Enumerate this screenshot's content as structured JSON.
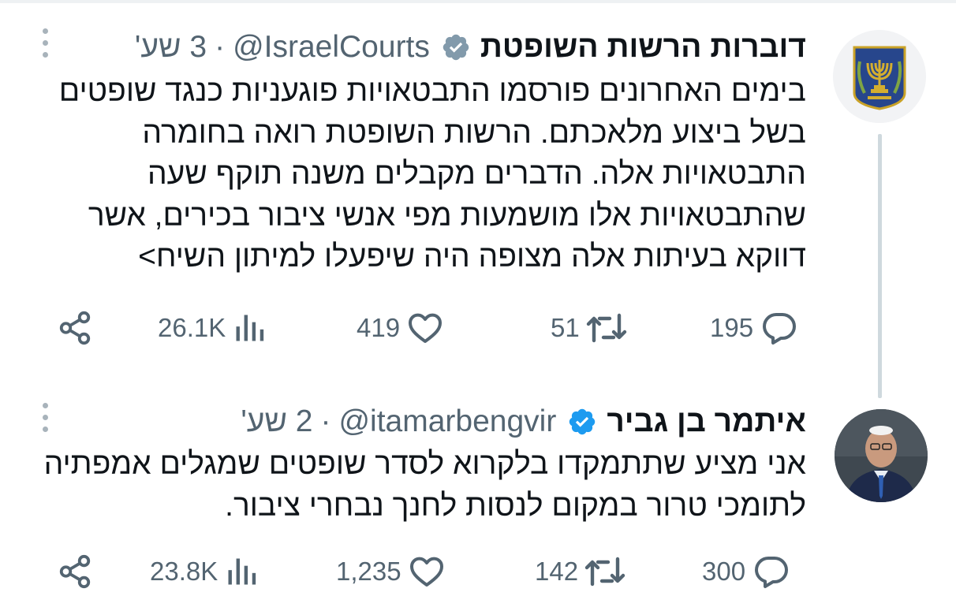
{
  "tweets": [
    {
      "name": "דוברות הרשות השופטת",
      "handle": "@IsraelCourts",
      "separator": "·",
      "time": "3 שע'",
      "avatar_icon": "menorah-emblem-icon",
      "verified_icon": "verified-badge-gray-icon",
      "verified_color": "#829aab",
      "lines": [
        "בימים האחרונים פורסמו התבטאויות פוגעניות כנגד שופטים",
        "בשל ביצוע מלאכתם. הרשות השופטת רואה בחומרה",
        "התבטאויות אלה. הדברים מקבלים משנה תוקף שעה",
        "שהתבטאויות אלו מושמעות מפי אנשי ציבור בכירים, אשר",
        "דווקא בעיתות אלה מצופה היה שיפעלו למיתון השיח>"
      ],
      "replies": "195",
      "retweets": "51",
      "likes": "419",
      "views": "26.1K"
    },
    {
      "name": "איתמר בן גביר",
      "handle": "@itamarbengvir",
      "separator": "·",
      "time": "2 שע'",
      "avatar_icon": "profile-photo-avatar",
      "verified_icon": "verified-badge-blue-icon",
      "verified_color": "#1d9bf0",
      "lines": [
        "אני מציע שתתמקדו בלקרוא לסדר שופטים שמגלים אמפתיה",
        "לתומכי טרור במקום לנסות לחנך נבחרי ציבור."
      ],
      "replies": "300",
      "retweets": "142",
      "likes": "1,235",
      "views": "23.8K"
    }
  ],
  "icons": {
    "reply": "reply-bubble-icon",
    "retweet": "retweet-icon",
    "like": "heart-icon",
    "views": "views-bar-chart-icon",
    "share": "share-icon",
    "more": "more-options-dots-icon"
  },
  "colors": {
    "text": "#0f1419",
    "secondary": "#536471",
    "thread_line": "#cfd9de"
  }
}
